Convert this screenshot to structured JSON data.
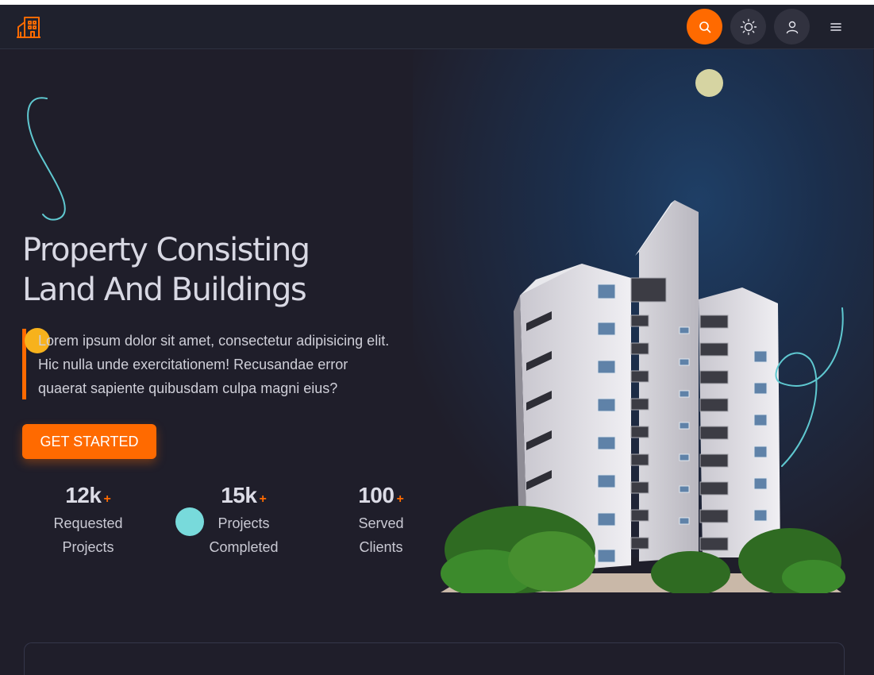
{
  "nav": {
    "logo_icon": "building-icon",
    "search_icon": "search-icon",
    "theme_icon": "sun-icon",
    "user_icon": "user-icon",
    "menu_icon": "menu-icon"
  },
  "hero": {
    "title_line1": "Property Consisting",
    "title_line2": "Land And Buildings",
    "desc_line1": "Lorem ipsum dolor sit amet, consectetur adipisicing elit.",
    "desc_line2": "Hic nulla unde exercitationem! Recusandae error",
    "desc_line3": "quaerat sapiente quibusdam culpa magni eius?",
    "cta_label": "GET STARTED"
  },
  "stats": [
    {
      "num": "12k",
      "plus": "+",
      "label1": "Requested",
      "label2": "Projects"
    },
    {
      "num": "15k",
      "plus": "+",
      "label1": "Projects",
      "label2": "Completed"
    },
    {
      "num": "100",
      "plus": "+",
      "label1": "Served",
      "label2": "Clients"
    }
  ],
  "colors": {
    "accent": "#ff6a00",
    "background": "#1f1e2a",
    "teal": "#78dadb",
    "yellow": "#f7b21c",
    "moon": "#d6d4a2"
  }
}
